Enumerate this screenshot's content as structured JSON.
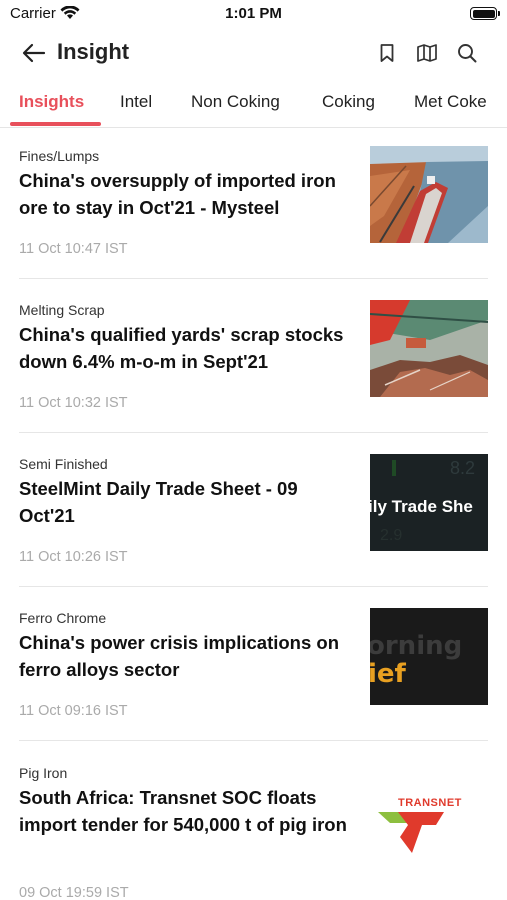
{
  "status_bar": {
    "carrier": "Carrier",
    "time": "1:01 PM"
  },
  "header": {
    "title": "Insight"
  },
  "tabs": [
    {
      "label": "Insights",
      "active": true
    },
    {
      "label": "Intel",
      "active": false
    },
    {
      "label": "Non Coking",
      "active": false
    },
    {
      "label": "Coking",
      "active": false
    },
    {
      "label": "Met Coke",
      "active": false
    }
  ],
  "articles": [
    {
      "category": "Fines/Lumps",
      "title": "China's oversupply of imported iron ore to stay in Oct'21 - Mysteel",
      "time": "11 Oct 10:47 IST",
      "thumbnail": "port-ship-photo"
    },
    {
      "category": "Melting Scrap",
      "title": "China's qualified yards' scrap stocks down 6.4% m-o-m in Sept'21",
      "time": "11 Oct 10:32 IST",
      "thumbnail": "scrap-yard-photo"
    },
    {
      "category": "Semi Finished",
      "title": "SteelMint Daily Trade Sheet - 09 Oct'21",
      "time": "11 Oct 10:26 IST",
      "thumbnail": "trade-sheet-graphic",
      "thumbnail_text": "ily Trade She"
    },
    {
      "category": "Ferro Chrome",
      "title": "China's power crisis implications on ferro alloys sector",
      "time": "11 Oct 09:16 IST",
      "thumbnail": "morning-brief-graphic",
      "thumbnail_text_1": "orning",
      "thumbnail_text_2": "ief"
    },
    {
      "category": "Pig Iron",
      "title": "South Africa: Transnet SOC floats import tender for 540,000 t of pig iron",
      "time": "09 Oct 19:59 IST",
      "thumbnail": "transnet-logo",
      "thumbnail_text": "TRANSNET"
    }
  ],
  "colors": {
    "accent": "#e8505b",
    "time_text": "#aaaaaa",
    "divider": "#e6e6e6"
  }
}
